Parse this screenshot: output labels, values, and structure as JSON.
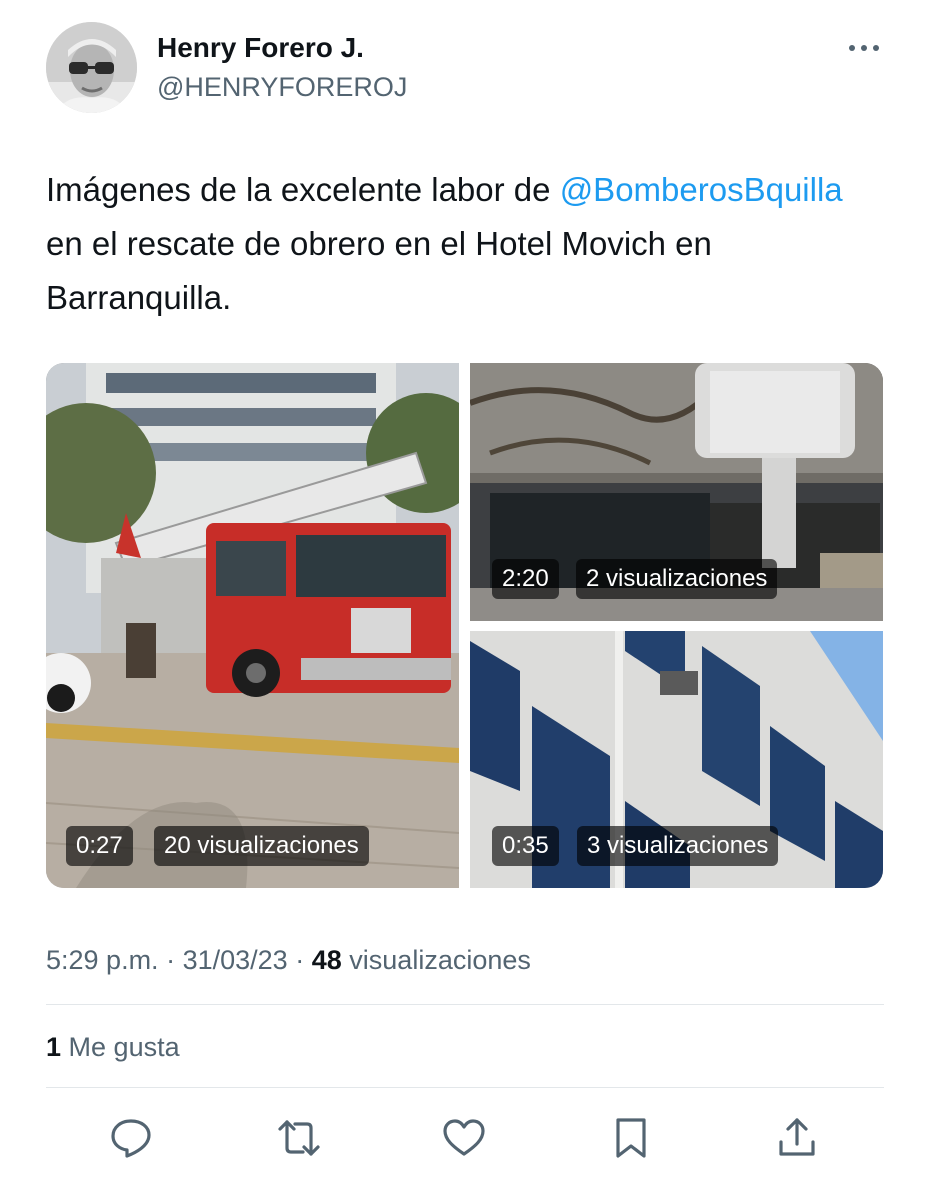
{
  "author": {
    "display_name": "Henry Forero J.",
    "handle": "@HENRYFOREROJ",
    "avatar_icon": "user-avatar"
  },
  "more_icon": "more-horizontal-icon",
  "tweet": {
    "text_before": "Imágenes de la excelente labor de ",
    "mention": "@BomberosBquilla",
    "text_after": " en el rescate de obrero en el Hotel Movich en Barranquilla."
  },
  "media": [
    {
      "duration": "0:27",
      "views": "20 visualizaciones"
    },
    {
      "duration": "2:20",
      "views": "2 visualizaciones"
    },
    {
      "duration": "0:35",
      "views": "3 visualizaciones"
    }
  ],
  "meta": {
    "time": "5:29 p.m.",
    "separator": "·",
    "date": "31/03/23",
    "views_count": "48",
    "views_label": "visualizaciones"
  },
  "likes": {
    "count": "1",
    "label": "Me gusta"
  },
  "actions": [
    {
      "icon": "reply-icon"
    },
    {
      "icon": "retweet-icon"
    },
    {
      "icon": "like-icon"
    },
    {
      "icon": "bookmark-icon"
    },
    {
      "icon": "share-icon"
    }
  ],
  "colors": {
    "accent": "#1d9bf0",
    "text_primary": "#0f1419",
    "text_secondary": "#536471",
    "divider": "#e3e7ea"
  }
}
